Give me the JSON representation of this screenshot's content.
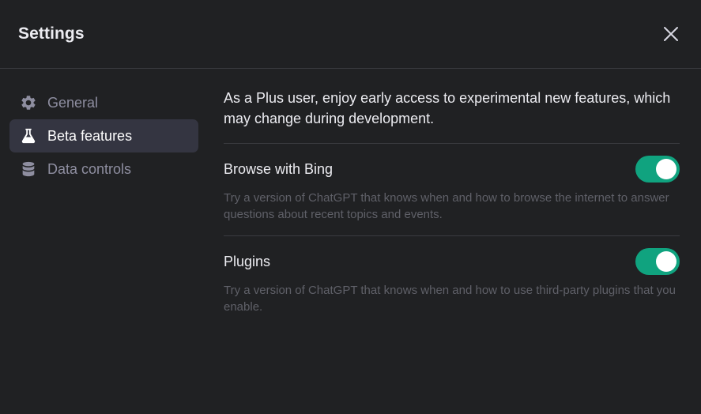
{
  "header": {
    "title": "Settings",
    "close_icon": "close-icon"
  },
  "sidebar": {
    "items": [
      {
        "label": "General",
        "icon": "gear-icon",
        "active": false
      },
      {
        "label": "Beta features",
        "icon": "flask-icon",
        "active": true
      },
      {
        "label": "Data controls",
        "icon": "database-icon",
        "active": false
      }
    ]
  },
  "content": {
    "intro": "As a Plus user, enjoy early access to experimental new features, which may change during development.",
    "features": [
      {
        "name": "Browse with Bing",
        "description": "Try a version of ChatGPT that knows when and how to browse the internet to answer questions about recent topics and events.",
        "enabled": true
      },
      {
        "name": "Plugins",
        "description": "Try a version of ChatGPT that knows when and how to use third-party plugins that you enable.",
        "enabled": true
      }
    ]
  },
  "colors": {
    "background": "#202123",
    "active_item": "#343541",
    "toggle_on": "#10a37f",
    "divider": "#3a3b40"
  }
}
